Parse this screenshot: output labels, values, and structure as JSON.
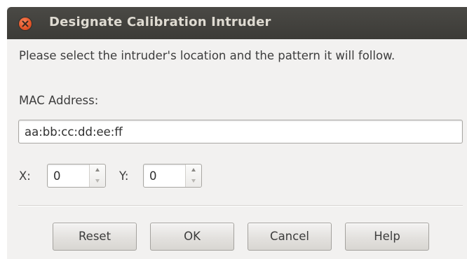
{
  "window": {
    "title": "Designate Calibration Intruder",
    "close_icon": "close-icon"
  },
  "instruction_text": "Please select the intruder's location and the pattern it will follow.",
  "mac_address": {
    "label": "MAC Address:",
    "value": "aa:bb:cc:dd:ee:ff"
  },
  "coordinates": {
    "x_label": "X:",
    "x_value": "0",
    "y_label": "Y:",
    "y_value": "0"
  },
  "buttons": {
    "reset": "Reset",
    "ok": "OK",
    "cancel": "Cancel",
    "help": "Help"
  },
  "colors": {
    "titlebar": "#3c3b37",
    "title_text": "#dfdbd2",
    "close_button": "#e4572a",
    "dialog_background": "#f2f1f0"
  }
}
